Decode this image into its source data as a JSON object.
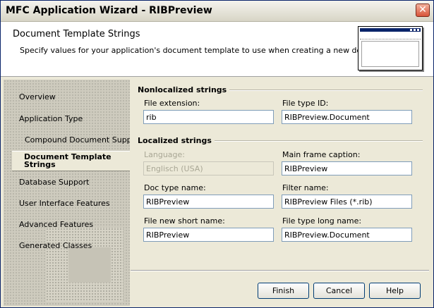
{
  "window": {
    "title": "MFC Application Wizard - RIBPreview",
    "close_glyph": "✕"
  },
  "header": {
    "title": "Document Template Strings",
    "description": "Specify values for your application's document template to use when creating a new document.",
    "preview_icon": "window-preview-icon"
  },
  "sidebar": {
    "items": [
      {
        "label": "Overview"
      },
      {
        "label": "Application Type"
      },
      {
        "label": "Compound Document Support"
      },
      {
        "label": "Document Template Strings",
        "active": true
      },
      {
        "label": "Database Support"
      },
      {
        "label": "User Interface Features"
      },
      {
        "label": "Advanced Features"
      },
      {
        "label": "Generated Classes"
      }
    ]
  },
  "nonlocalized": {
    "heading": "Nonlocalized strings",
    "file_extension": {
      "label": "File extension:",
      "value": "rib"
    },
    "file_type_id": {
      "label": "File type ID:",
      "value": "RIBPreview.Document"
    }
  },
  "localized": {
    "heading": "Localized strings",
    "language": {
      "label": "Language:",
      "value": "Englisch (USA)"
    },
    "main_frame_caption": {
      "label": "Main frame caption:",
      "value": "RIBPreview"
    },
    "doc_type_name": {
      "label": "Doc type name:",
      "value": "RIBPreview"
    },
    "filter_name": {
      "label": "Filter name:",
      "value": "RIBPreview Files (*.rib)"
    },
    "file_new_short_name": {
      "label": "File new short name:",
      "value": "RIBPreview"
    },
    "file_type_long_name": {
      "label": "File type long name:",
      "value": "RIBPreview.Document"
    }
  },
  "buttons": {
    "finish": "Finish",
    "cancel": "Cancel",
    "help": "Help"
  },
  "colors": {
    "title_border": "#0a246a",
    "dialog_face": "#ece9d8",
    "sidebar_bg": "#c6c3b6",
    "field_border": "#7f9db9",
    "disabled_text": "#a9a795"
  }
}
